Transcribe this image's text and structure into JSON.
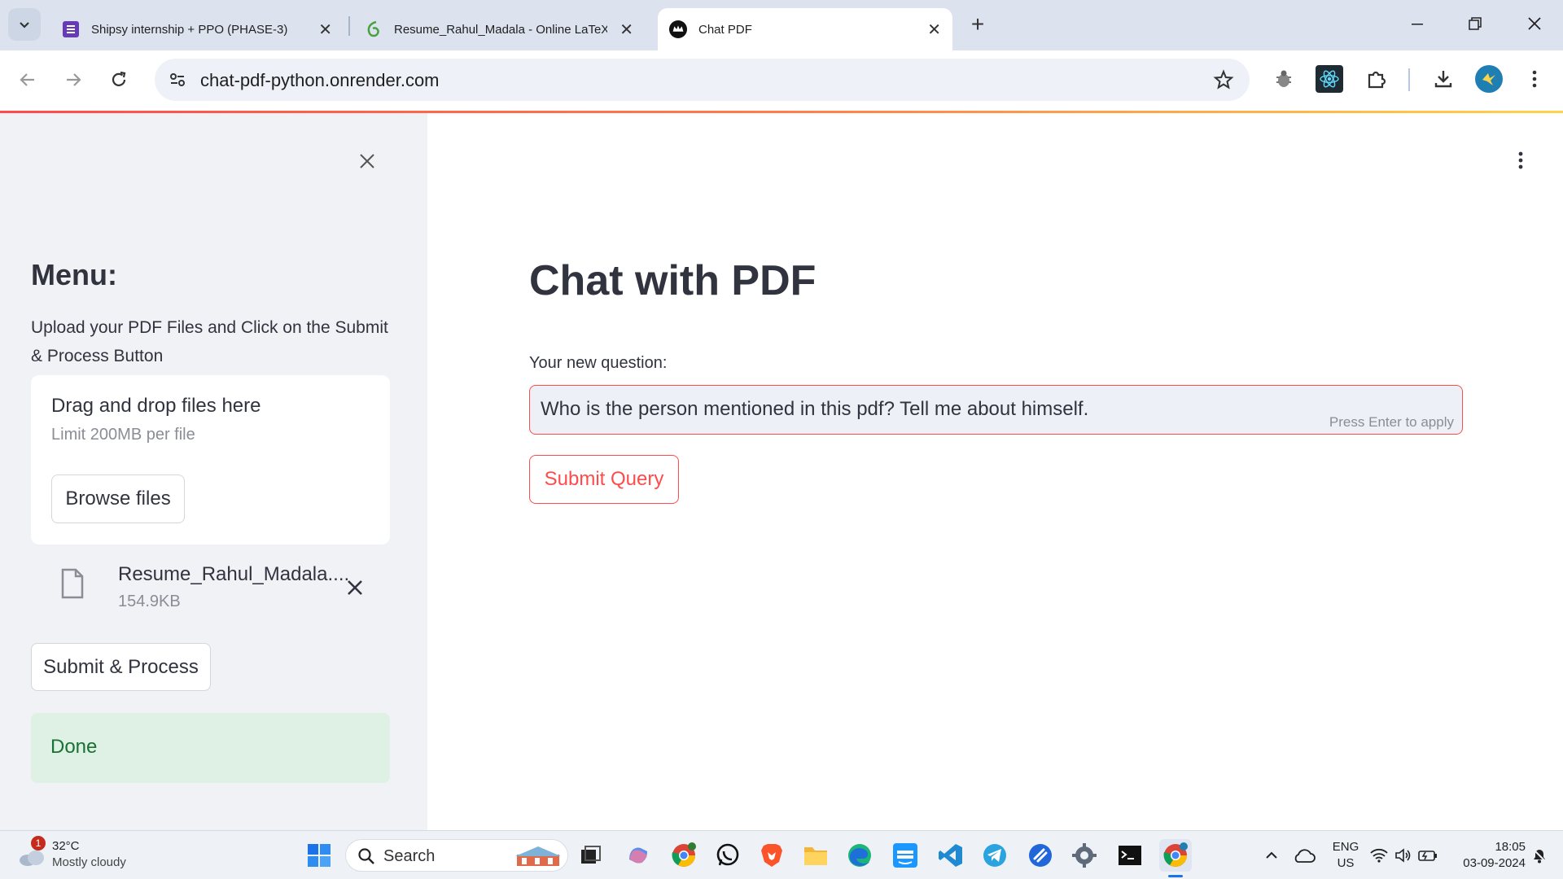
{
  "browser": {
    "tabs": [
      {
        "title": "Shipsy internship + PPO (PHASE-3)",
        "icon": "forms-icon",
        "active": false
      },
      {
        "title": "Resume_Rahul_Madala - Online LaTeX",
        "icon": "overleaf-icon",
        "active": false
      },
      {
        "title": "Chat PDF",
        "icon": "streamlit-crown-icon",
        "active": true
      }
    ],
    "url": "chat-pdf-python.onrender.com"
  },
  "sidebar": {
    "heading": "Menu:",
    "instructions": "Upload your PDF Files and Click on the Submit & Process Button",
    "uploader": {
      "drag_text": "Drag and drop files here",
      "limit_text": "Limit 200MB per file",
      "browse_label": "Browse files"
    },
    "file": {
      "name": "Resume_Rahul_Madala....",
      "size": "154.9KB"
    },
    "submit_label": "Submit & Process",
    "status": "Done"
  },
  "main": {
    "title": "Chat with PDF",
    "question_label": "Your new question:",
    "question_value": "Who is the person mentioned in this pdf? Tell me about himself.",
    "hint": "Press Enter to apply",
    "submit_query_label": "Submit Query"
  },
  "taskbar": {
    "weather_temp": "32°C",
    "weather_desc": "Mostly cloudy",
    "weather_badge": "1",
    "search_placeholder": "Search",
    "lang_line1": "ENG",
    "lang_line2": "US",
    "time": "18:05",
    "date": "03-09-2024"
  },
  "colors": {
    "accent": "#ff4b4b",
    "success_bg": "#dff0e4",
    "success_text": "#177233",
    "sidebar_bg": "#f0f2f6"
  }
}
